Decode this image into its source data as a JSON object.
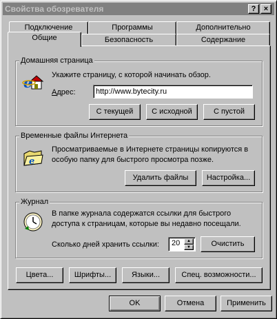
{
  "window": {
    "title": "Свойства обозревателя"
  },
  "titlebar_buttons": {
    "help": "?",
    "close": "×"
  },
  "tabs": {
    "back": [
      "Подключение",
      "Программы",
      "Дополнительно"
    ],
    "front": [
      "Общие",
      "Безопасность",
      "Содержание"
    ],
    "active": "Общие"
  },
  "home": {
    "legend": "Домашняя страница",
    "desc": "Укажите страницу, с которой начинать обзор.",
    "address_label_pre": "",
    "address_label_ul": "А",
    "address_label_post": "дрес:",
    "address_value": "http://www.bytecity.ru",
    "buttons": [
      "С текущей",
      "С исходной",
      "С пустой"
    ]
  },
  "temp": {
    "legend": "Временные файлы Интернета",
    "desc_line1": "Просматриваемые в Интернете страницы копируются в",
    "desc_line2": "особую папку для быстрого просмотра позже.",
    "buttons": [
      "Удалить файлы",
      "Настройка..."
    ]
  },
  "history": {
    "legend": "Журнал",
    "desc_line1": "В папке журнала содержатся ссылки для быстрого",
    "desc_line2": "доступа к страницам, которые вы недавно посещали.",
    "days_label": "Сколько дней хранить ссылки:",
    "days_value": "20",
    "clear_button": "Очистить"
  },
  "bottom_buttons": [
    "Цвета...",
    "Шрифты...",
    "Языки...",
    "Спец. возможности..."
  ],
  "dialog_buttons": {
    "ok": "OK",
    "cancel": "Отмена",
    "apply": "Применить"
  }
}
